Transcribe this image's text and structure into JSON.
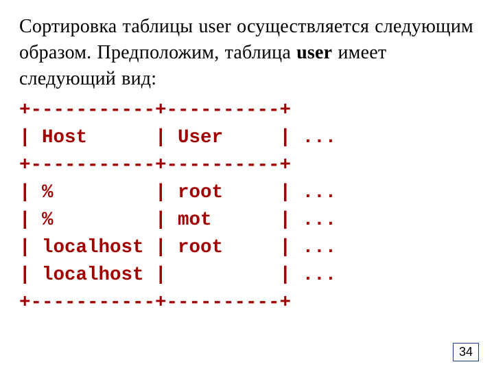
{
  "intro": {
    "part1": "Сортировка таблицы user осуществляется следующим образом. Предположим, таблица ",
    "bold": "user",
    "part2": " имеет следующий вид:"
  },
  "ascii": {
    "l1": "+-----------+----------+",
    "l2": "| Host      | User     | ...",
    "l3": "+-----------+----------+",
    "l4": "| %         | root     | ...",
    "l5": "| %         | mot      | ...",
    "l6": "| localhost | root     | ...",
    "l7": "| localhost |          | ...",
    "l8": "+-----------+----------+"
  },
  "page_number": "34"
}
